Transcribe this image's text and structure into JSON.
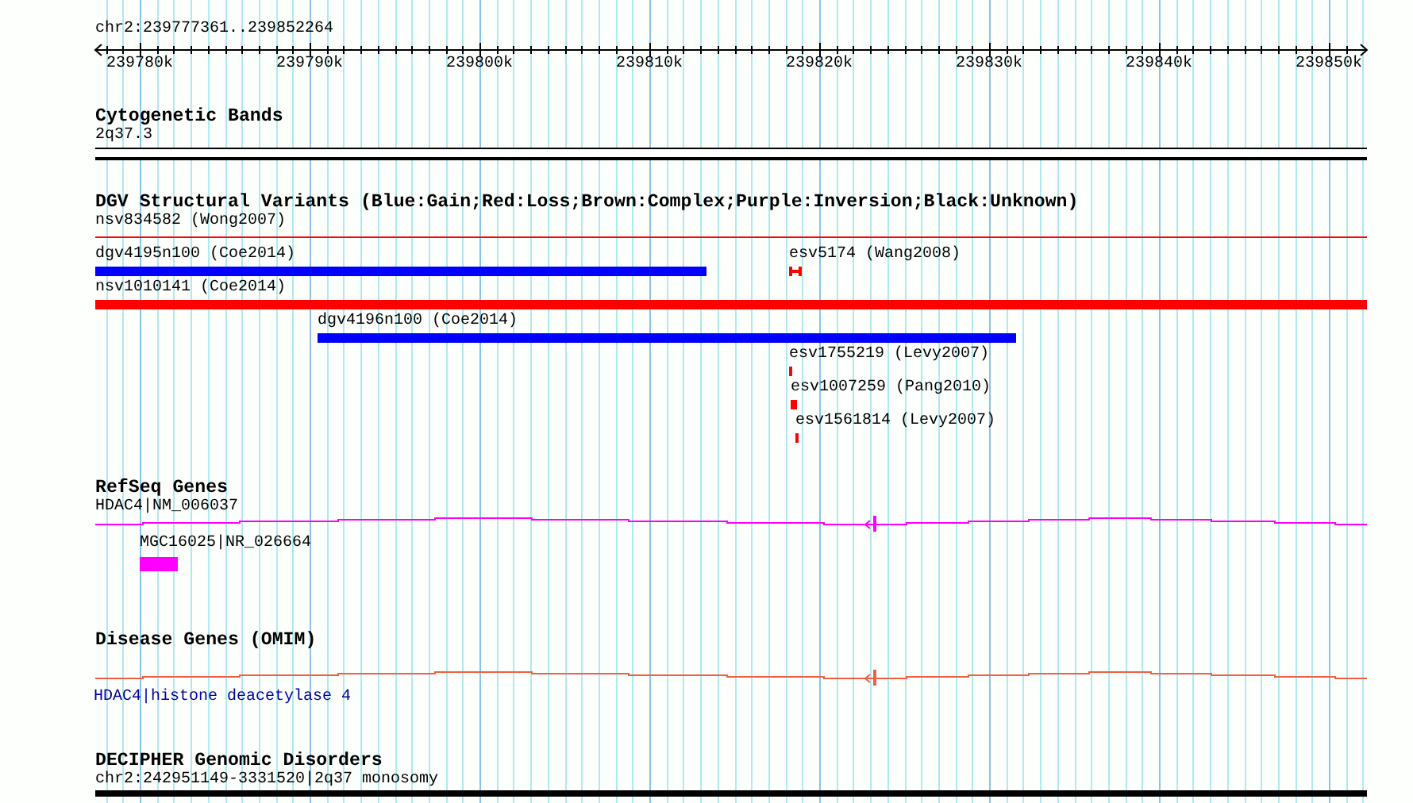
{
  "ruler": {
    "range": "chr2:239777361..239852264",
    "ticks": [
      "239780k",
      "239790k",
      "239800k",
      "239810k",
      "239820k",
      "239830k",
      "239840k",
      "239850k"
    ]
  },
  "tracks": [
    {
      "title": "Cytogenetic Bands",
      "kind": "bands",
      "features": [
        {
          "label": "2q37.3"
        }
      ]
    },
    {
      "title": "DGV Structural Variants (Blue:Gain;Red:Loss;Brown:Complex;Purple:Inversion;Black:Unknown)",
      "kind": "variants",
      "features": [
        {
          "label": "nsv834582 (Wong2007)",
          "color": "#ff0000"
        },
        {
          "label": "dgv4195n100 (Coe2014)",
          "color": "#0000ff"
        },
        {
          "label": "esv5174 (Wang2008)",
          "color": "#ff0000"
        },
        {
          "label": "nsv1010141 (Coe2014)",
          "color": "#ff0000"
        },
        {
          "label": "dgv4196n100 (Coe2014)",
          "color": "#0000ff"
        },
        {
          "label": "esv1755219 (Levy2007)",
          "color": "#ff0000"
        },
        {
          "label": "esv1007259 (Pang2010)",
          "color": "#ff0000"
        },
        {
          "label": "esv1561814 (Levy2007)",
          "color": "#ff0000"
        }
      ]
    },
    {
      "title": "RefSeq Genes",
      "kind": "genes",
      "features": [
        {
          "label": "HDAC4|NM_006037"
        },
        {
          "label": "MGC16025|NR_026664"
        }
      ]
    },
    {
      "title": "Disease Genes (OMIM)",
      "kind": "disease_genes",
      "features": [
        {
          "label": "HDAC4|histone deacetylase 4"
        }
      ]
    },
    {
      "title": "DECIPHER Genomic Disorders",
      "kind": "disorders",
      "features": [
        {
          "label": "chr2:242951149-3331520|2q37 monosomy"
        }
      ]
    }
  ]
}
